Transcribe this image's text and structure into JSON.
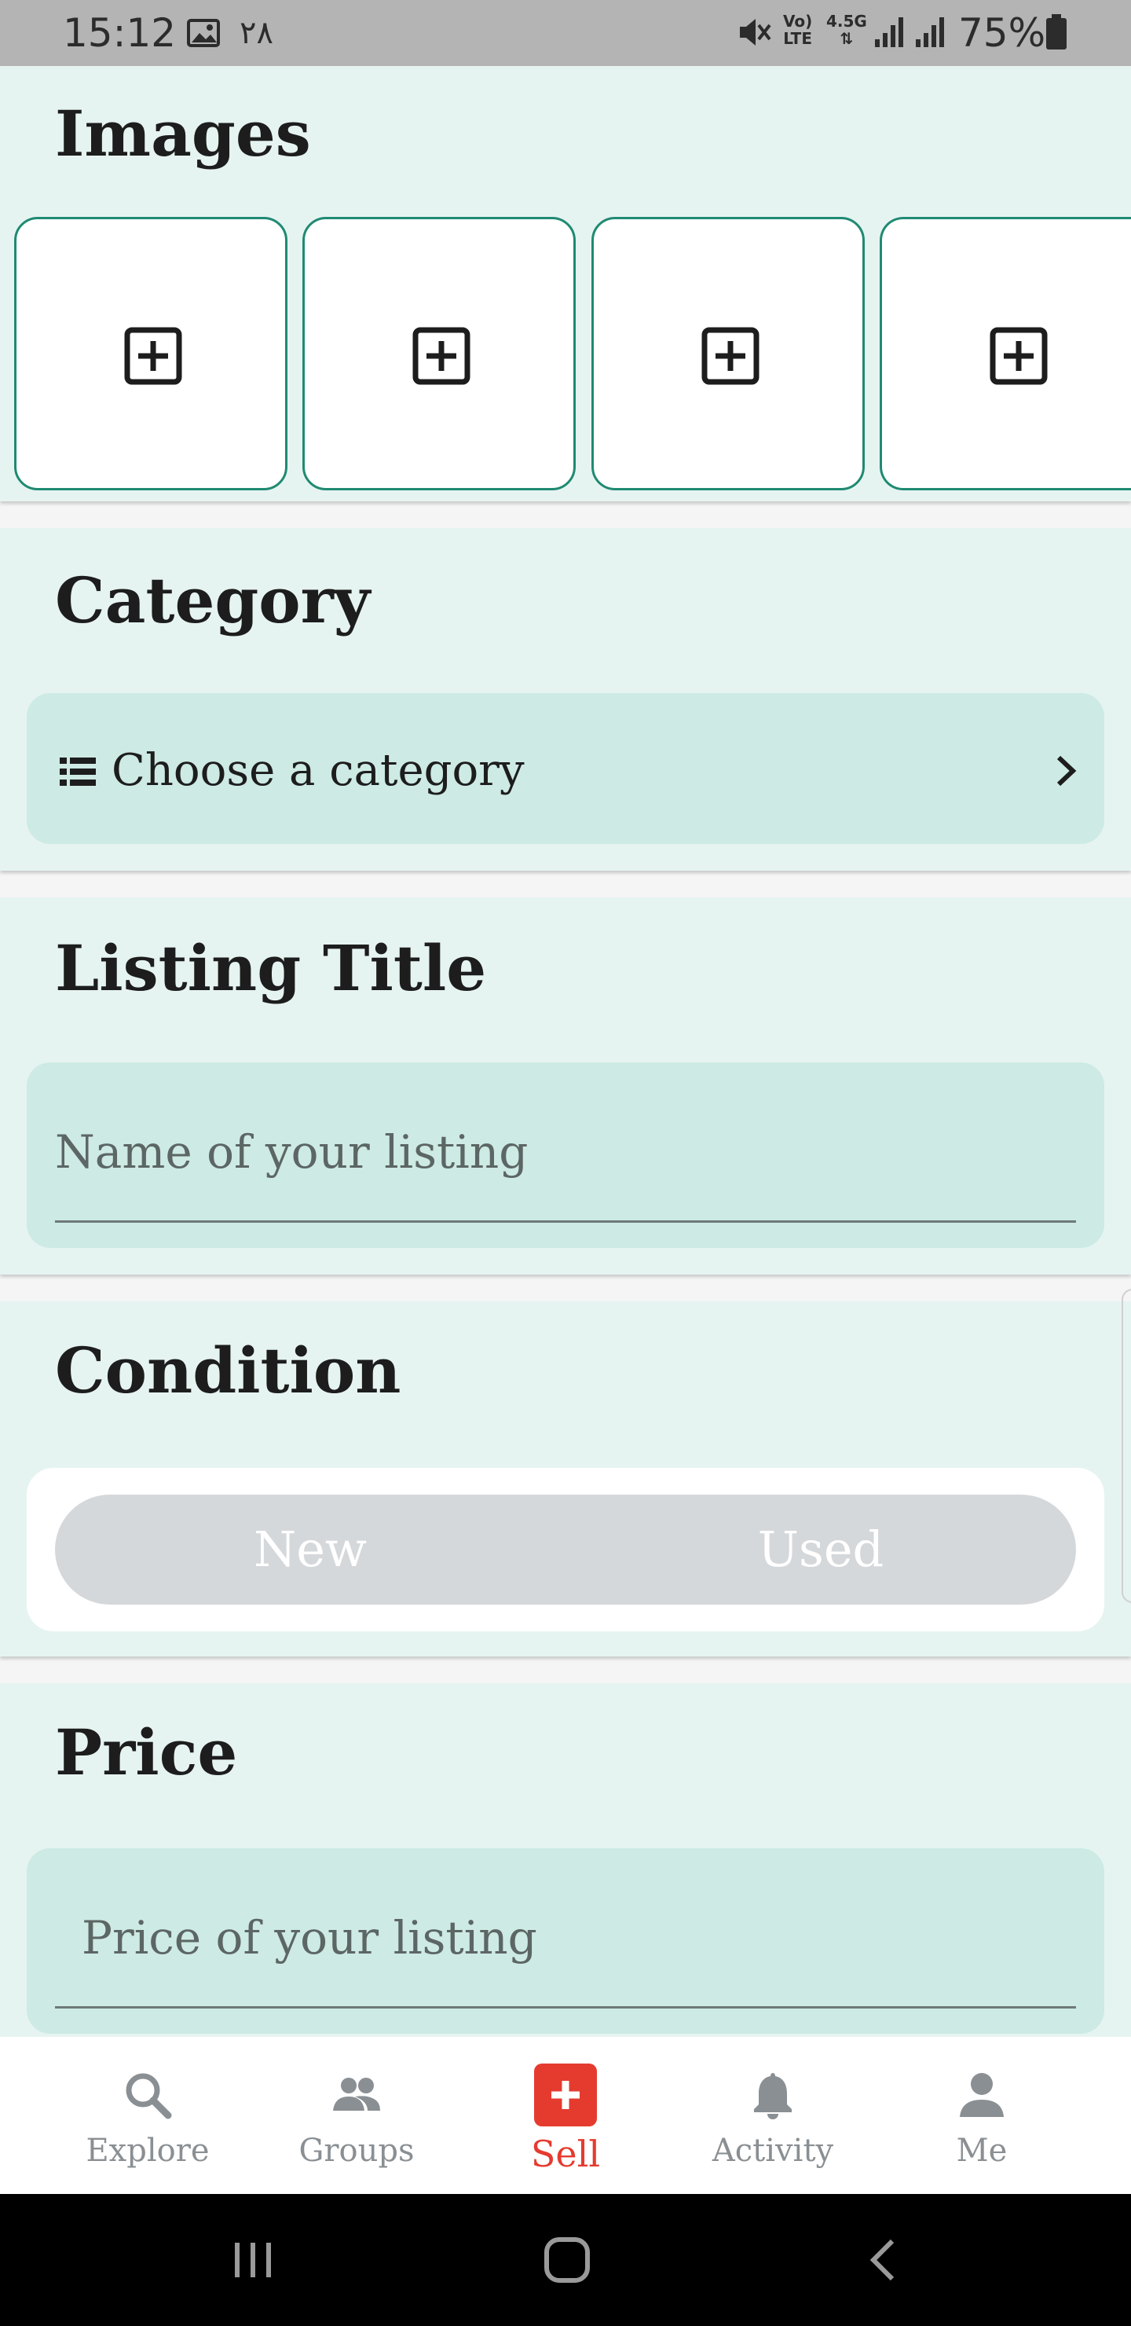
{
  "status_bar": {
    "time": "15:12",
    "extra": "٢٨",
    "volte": [
      "Vo)",
      "LTE"
    ],
    "network": [
      "4.5G",
      "⇅"
    ],
    "battery": "75%"
  },
  "sections": {
    "images": {
      "title": "Images",
      "slots": 4,
      "accent": "#1f8a73"
    },
    "category": {
      "title": "Category",
      "select_label": "Choose a category"
    },
    "listing_title": {
      "title": "Listing Title",
      "placeholder": "Name of your listing"
    },
    "condition": {
      "title": "Condition",
      "options": [
        "New",
        "Used"
      ]
    },
    "price": {
      "title": "Price",
      "placeholder": "Price of your listing"
    }
  },
  "bottom_nav": {
    "items": [
      {
        "label": "Explore",
        "icon": "search-icon"
      },
      {
        "label": "Groups",
        "icon": "groups-icon"
      },
      {
        "label": "Sell",
        "icon": "plus-icon",
        "active": true,
        "color": "#e53b2f"
      },
      {
        "label": "Activity",
        "icon": "bell-icon"
      },
      {
        "label": "Me",
        "icon": "person-icon"
      }
    ]
  },
  "colors": {
    "section_bg": "#e6f4f1",
    "field_bg": "#cdeae4",
    "accent_red": "#e53b2f"
  }
}
